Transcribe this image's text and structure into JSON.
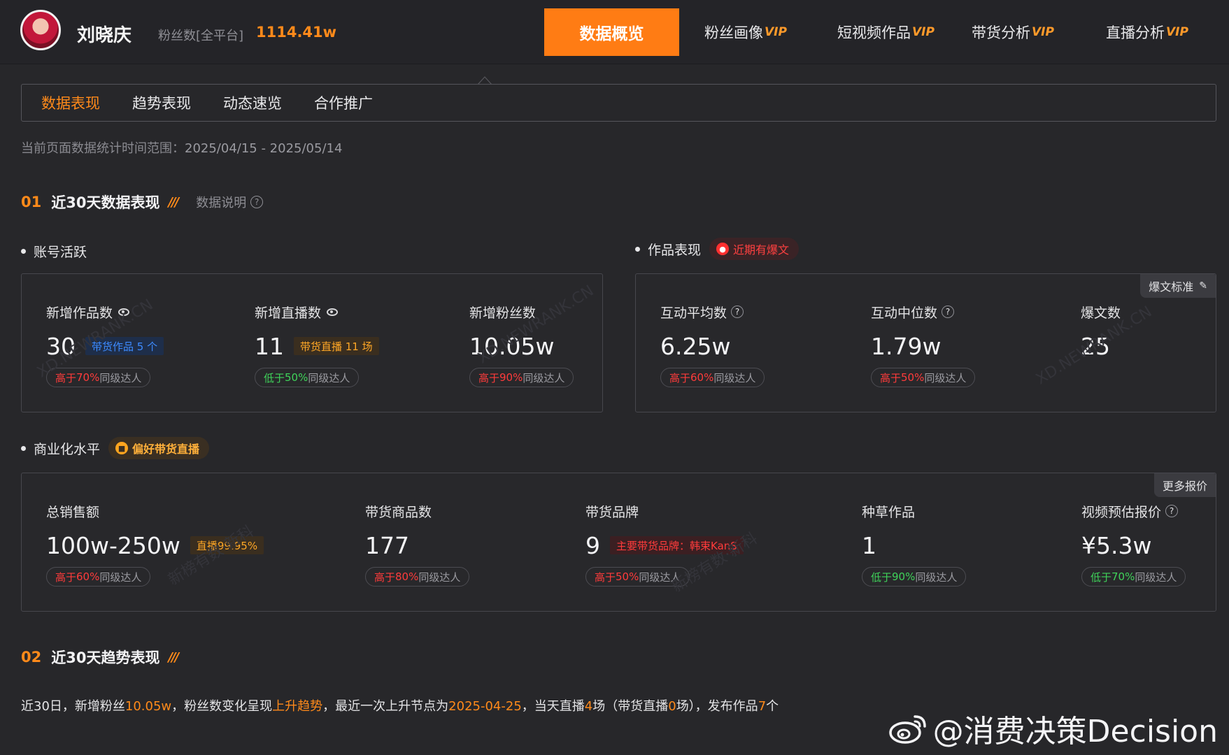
{
  "header": {
    "user_name": "刘晓庆",
    "fans_label": "粉丝数[全平台]",
    "fans_value": "1114.41w",
    "nav": [
      {
        "label": "数据概览",
        "vip": ""
      },
      {
        "label": "粉丝画像",
        "vip": "VIP"
      },
      {
        "label": "短视频作品",
        "vip": "VIP"
      },
      {
        "label": "带货分析",
        "vip": "VIP"
      },
      {
        "label": "直播分析",
        "vip": "VIP"
      }
    ]
  },
  "tabs": [
    "数据表现",
    "趋势表现",
    "动态速览",
    "合作推广"
  ],
  "date_range": {
    "label": "当前页面数据统计时间范围：",
    "value": "2025/04/15 - 2025/05/14"
  },
  "section1": {
    "num": "01",
    "title": "近30天数据表现",
    "explain": "数据说明"
  },
  "account": {
    "title": "账号活跃",
    "metrics": [
      {
        "label": "新增作品数",
        "value": "30",
        "badge": "带货作品 5 个",
        "cmp_prefix": "高于",
        "cmp_pct": "70%",
        "cmp_suffix": "同级达人"
      },
      {
        "label": "新增直播数",
        "value": "11",
        "badge": "带货直播 11 场",
        "cmp_prefix": "低于",
        "cmp_pct": "50%",
        "cmp_suffix": "同级达人"
      },
      {
        "label": "新增粉丝数",
        "value": "10.05w",
        "cmp_prefix": "高于",
        "cmp_pct": "90%",
        "cmp_suffix": "同级达人"
      }
    ]
  },
  "works": {
    "title": "作品表现",
    "tag": "近期有爆文",
    "corner": "爆文标准",
    "metrics": [
      {
        "label": "互动平均数",
        "value": "6.25w",
        "cmp_prefix": "高于",
        "cmp_pct": "60%",
        "cmp_suffix": "同级达人"
      },
      {
        "label": "互动中位数",
        "value": "1.79w",
        "cmp_prefix": "高于",
        "cmp_pct": "50%",
        "cmp_suffix": "同级达人"
      },
      {
        "label": "爆文数",
        "value": "25"
      }
    ]
  },
  "commerce": {
    "title": "商业化水平",
    "tag": "偏好带货直播",
    "corner": "更多报价",
    "metrics": [
      {
        "label": "总销售额",
        "value": "100w-250w",
        "badge": "直播99.95%",
        "cmp_prefix": "高于",
        "cmp_pct": "60%",
        "cmp_suffix": "同级达人"
      },
      {
        "label": "带货商品数",
        "value": "177",
        "cmp_prefix": "高于",
        "cmp_pct": "80%",
        "cmp_suffix": "同级达人"
      },
      {
        "label": "带货品牌",
        "value": "9",
        "badge": "主要带货品牌：韩束KanS",
        "cmp_prefix": "高于",
        "cmp_pct": "50%",
        "cmp_suffix": "同级达人"
      },
      {
        "label": "种草作品",
        "value": "1",
        "cmp_prefix": "低于",
        "cmp_pct": "90%",
        "cmp_suffix": "同级达人"
      },
      {
        "label": "视频预估报价",
        "value": "¥5.3w",
        "cmp_prefix": "低于",
        "cmp_pct": "70%",
        "cmp_suffix": "同级达人"
      }
    ]
  },
  "section2": {
    "num": "02",
    "title": "近30天趋势表现"
  },
  "summary": {
    "p1": "近30日，新增粉丝",
    "v1": "10.05w",
    "p2": "，粉丝数变化呈现",
    "v2": "上升趋势",
    "p3": "，最近一次上升节点为",
    "v3": "2025-04-25",
    "p4": "，当天直播",
    "v4": "4",
    "p5": "场（带货直播",
    "v5": "0",
    "p6": "场），发布作品",
    "v6": "7",
    "p7": "个"
  },
  "watermarks": [
    "XD.NEWRANK.CN",
    "新榜有数·新科"
  ],
  "weibo_handle": "@消费决策Decision",
  "colors": {
    "accent": "#ff7c14",
    "up": "#ff3b3b",
    "down": "#3fd35a",
    "bg": "#27272a"
  }
}
